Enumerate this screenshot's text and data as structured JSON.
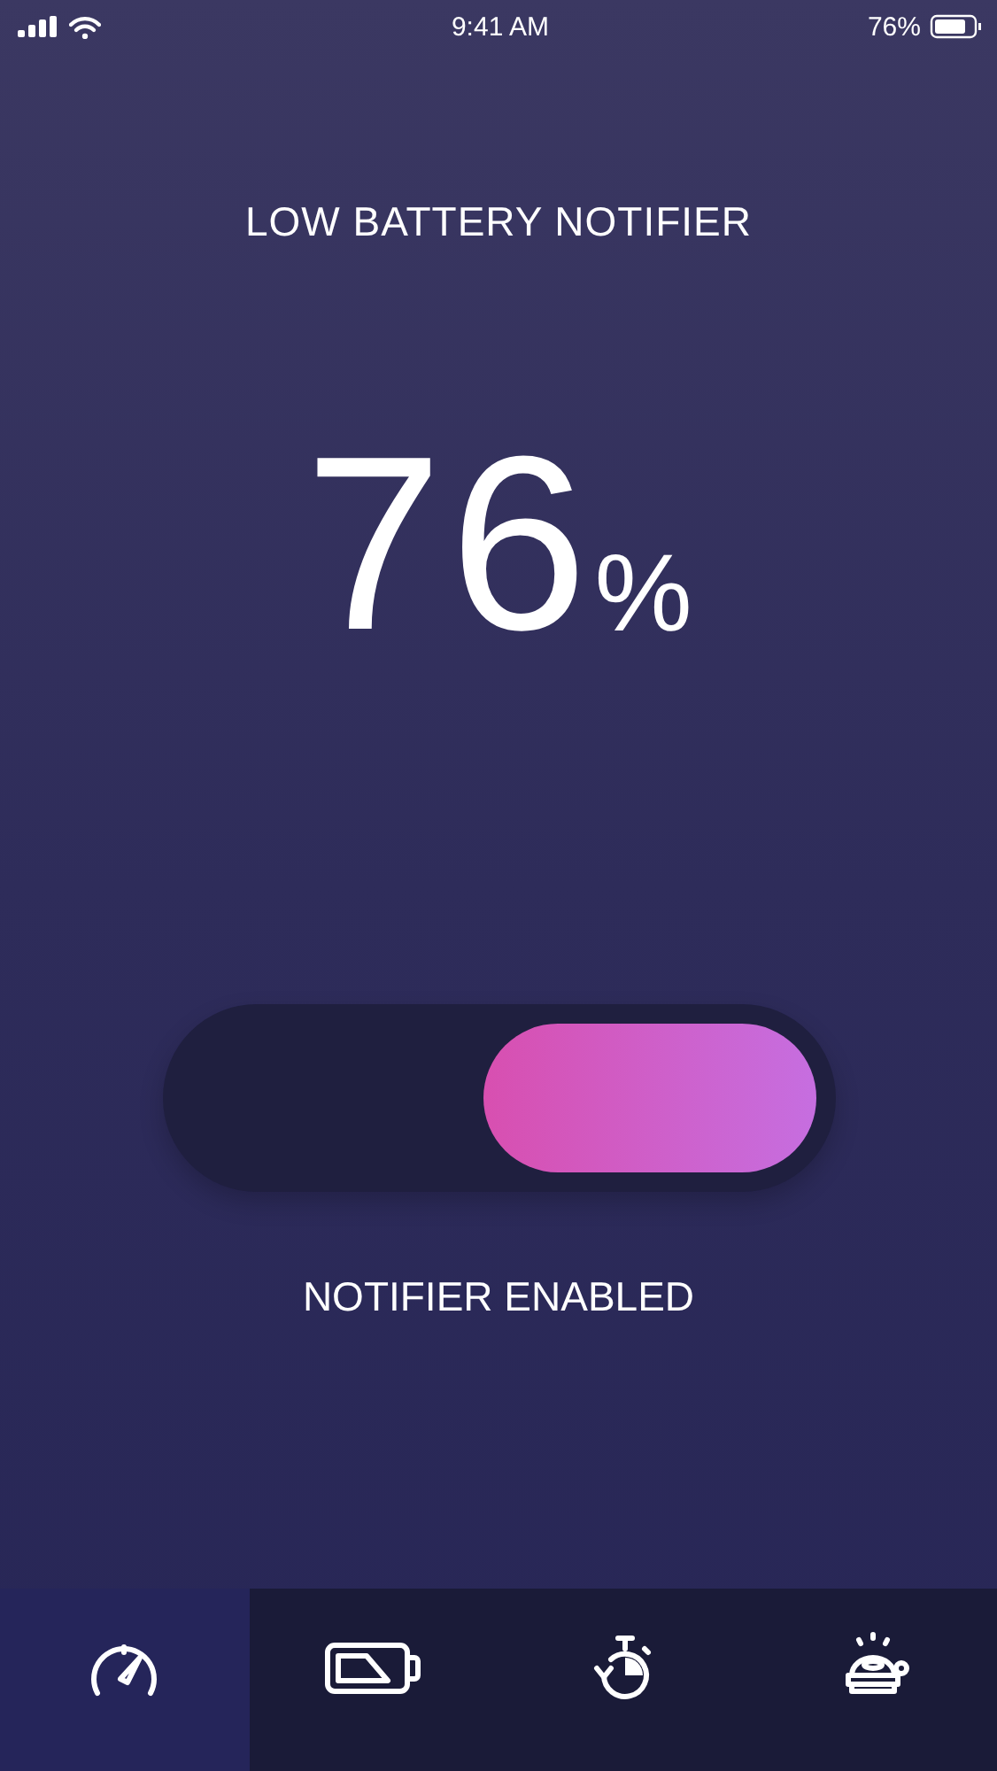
{
  "status_bar": {
    "time": "9:41 AM",
    "battery": "76%"
  },
  "title": "LOW BATTERY NOTIFIER",
  "charge": {
    "value": "76",
    "unit": "%"
  },
  "notifier_switch": {
    "on": true
  },
  "switch_label": "NOTIFIER ENABLED",
  "tabs": [
    {
      "kind": "gauge",
      "selected": true
    },
    {
      "kind": "battery",
      "selected": false
    },
    {
      "kind": "timer",
      "selected": false
    },
    {
      "kind": "bell",
      "selected": false
    }
  ]
}
